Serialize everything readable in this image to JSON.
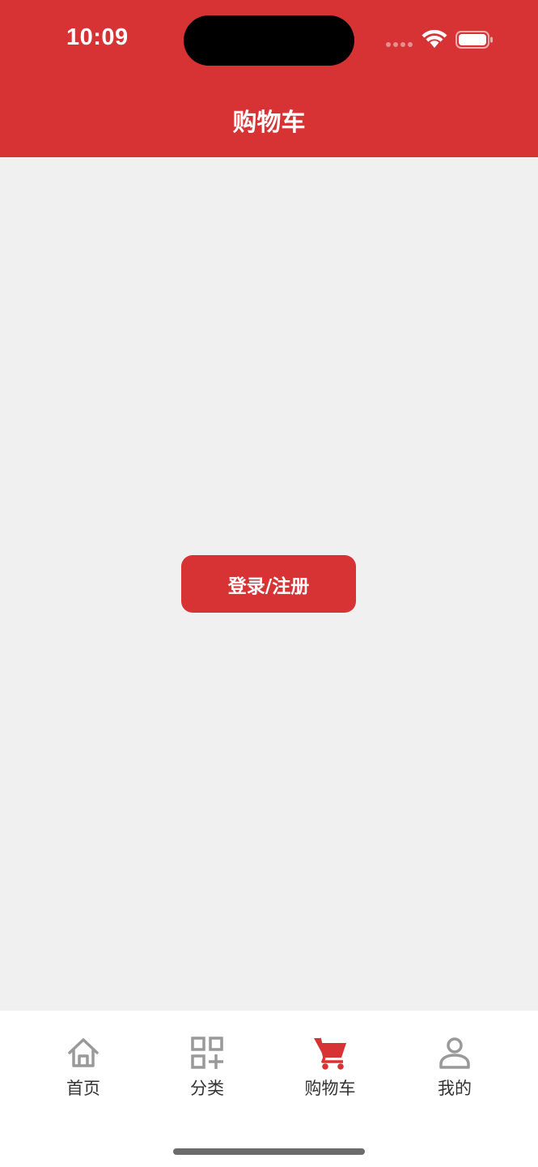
{
  "status_bar": {
    "time": "10:09"
  },
  "header": {
    "title": "购物车",
    "background_color": "#d73234"
  },
  "main": {
    "login_button_label": "登录/注册"
  },
  "tabbar": {
    "active_color": "#d73234",
    "inactive_color": "#999999",
    "tabs": [
      {
        "label": "首页",
        "icon": "home-icon",
        "active": false
      },
      {
        "label": "分类",
        "icon": "category-icon",
        "active": false
      },
      {
        "label": "购物车",
        "icon": "cart-icon",
        "active": true
      },
      {
        "label": "我的",
        "icon": "user-icon",
        "active": false
      }
    ]
  }
}
